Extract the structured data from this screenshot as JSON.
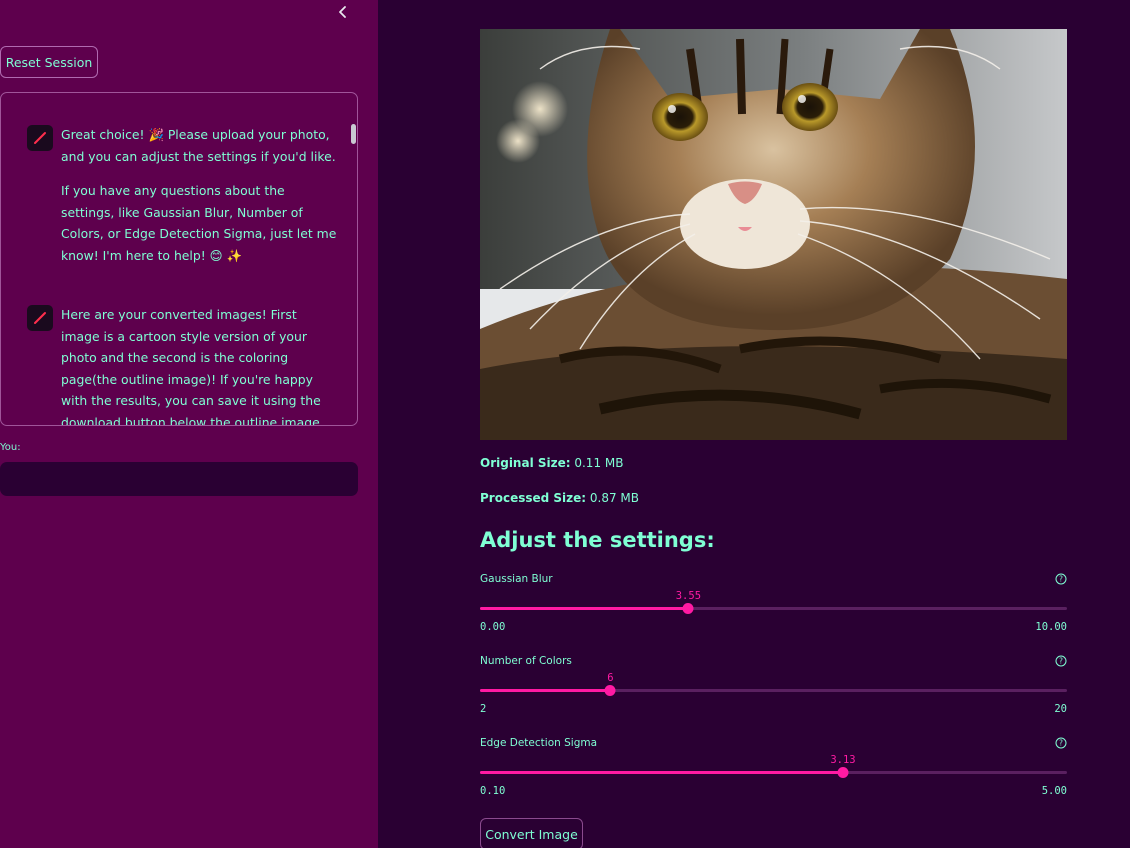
{
  "sidebar": {
    "reset_label": "Reset Session",
    "messages": [
      {
        "paragraphs": [
          "Great choice! 🎉 Please upload your photo, and you can adjust the settings if you'd like.",
          "If you have any questions about the settings, like Gaussian Blur, Number of Colors, or Edge Detection Sigma, just let me know! I'm here to help! 😊 ✨"
        ]
      },
      {
        "paragraphs": [
          "Here are your converted images! First image is a cartoon style version of your photo and the second is the coloring page(the outline image)! If you're happy with the results, you can save it using the download button below the outline image."
        ]
      }
    ],
    "you_label": "You:",
    "input_value": ""
  },
  "main": {
    "original_size_label": "Original Size:",
    "original_size_value": " 0.11 MB",
    "processed_size_label": "Processed Size:",
    "processed_size_value": " 0.87 MB",
    "settings_title": "Adjust the settings:",
    "sliders": [
      {
        "label": "Gaussian Blur",
        "value": 3.55,
        "value_text": "3.55",
        "min": 0.0,
        "max": 10.0,
        "min_text": "0.00",
        "max_text": "10.00"
      },
      {
        "label": "Number of Colors",
        "value": 6,
        "value_text": "6",
        "min": 2,
        "max": 20,
        "min_text": "2",
        "max_text": "20"
      },
      {
        "label": "Edge Detection Sigma",
        "value": 3.13,
        "value_text": "3.13",
        "min": 0.1,
        "max": 5.0,
        "min_text": "0.10",
        "max_text": "5.00"
      }
    ],
    "convert_label": "Convert Image"
  },
  "colors": {
    "sidebar_bg": "#5e004d",
    "main_bg": "#2a0033",
    "text": "#7fffd4",
    "accent": "#ff1aa3"
  },
  "icons": {
    "collapse": "chevron-left-icon",
    "avatar": "pencil-icon",
    "help": "question-circle-icon"
  }
}
